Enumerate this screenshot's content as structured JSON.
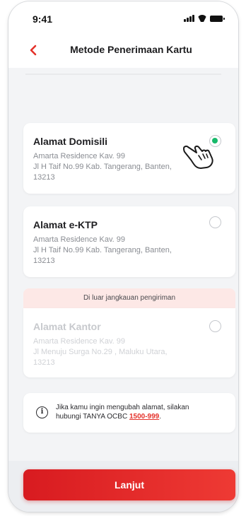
{
  "status": {
    "time": "9:41"
  },
  "header": {
    "title": "Metode Penerimaan Kartu"
  },
  "options": [
    {
      "title": "Alamat Domisili",
      "line1": "Amarta Residence Kav. 99",
      "line2": "Jl H Taif No.99 Kab. Tangerang, Banten,",
      "line3": "13213",
      "selected": true
    },
    {
      "title": "Alamat e-KTP",
      "line1": "Amarta Residence Kav. 99",
      "line2": "Jl H Taif No.99 Kab. Tangerang, Banten,",
      "line3": "13213",
      "selected": false
    },
    {
      "title": "Alamat Kantor",
      "line1": "Amarta Residence Kav. 99",
      "line2": "Jl Menuju Surga No.29 , Maluku Utara,",
      "line3": "13213",
      "selected": false,
      "disabled": true
    }
  ],
  "unavailable_notice": "Di luar jangkauan pengiriman",
  "info": {
    "text_line1": "Jika kamu ingin mengubah alamat, silakan",
    "text_line2_prefix": "hubungi TANYA OCBC ",
    "phone": "1500-999",
    "text_line2_suffix": "."
  },
  "cta": {
    "label": "Lanjut"
  },
  "colors": {
    "accent": "#e4312a",
    "selected": "#17b96a",
    "banner": "#fde8e6"
  },
  "icons": {
    "back": "chevron-left-icon",
    "info": "info-icon",
    "pointer": "hand-pointer-icon"
  }
}
